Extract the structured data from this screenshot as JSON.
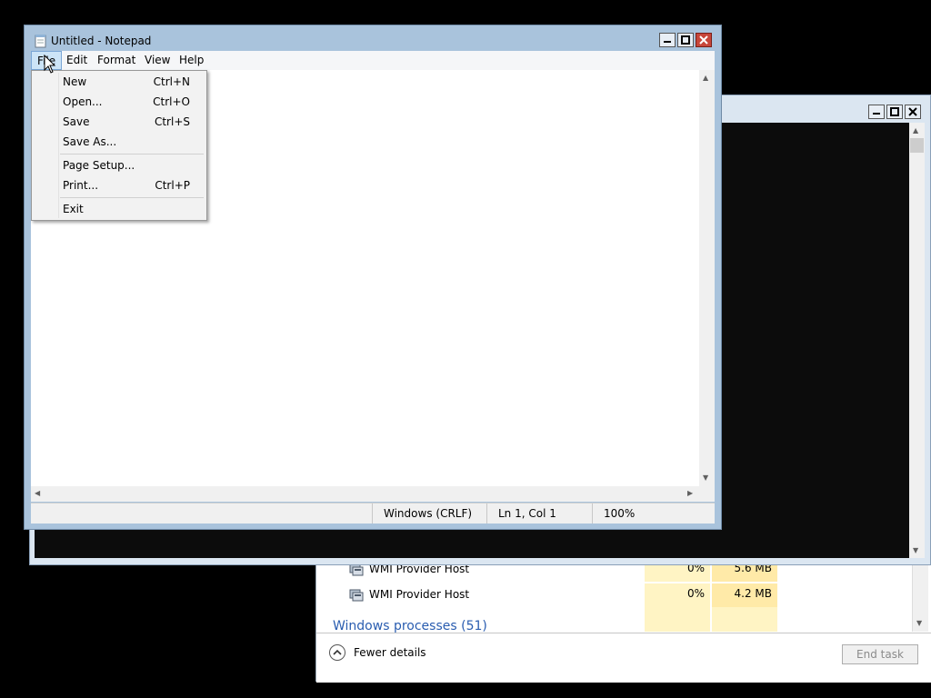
{
  "colors": {
    "titlebar": "#a9c3dc",
    "accent_link": "#2a5db0",
    "cpu_fill": "#fff4c4",
    "mem_fill": "#ffeaa8"
  },
  "taskmgr": {
    "rows": [
      {
        "name": "WMI Provider Host",
        "cpu": "0%",
        "memory": "5.6 MB",
        "icon": "service-host-icon"
      },
      {
        "name": "WMI Provider Host",
        "cpu": "0%",
        "memory": "4.2 MB",
        "icon": "service-host-icon"
      }
    ],
    "group_header": "Windows processes (51)",
    "fewer_details": "Fewer details",
    "end_task": "End task"
  },
  "notepad": {
    "title": "Untitled - Notepad",
    "menu": [
      "File",
      "Edit",
      "Format",
      "View",
      "Help"
    ],
    "file_menu": {
      "items": [
        {
          "label": "New",
          "shortcut": "Ctrl+N"
        },
        {
          "label": "Open...",
          "shortcut": "Ctrl+O"
        },
        {
          "label": "Save",
          "shortcut": "Ctrl+S"
        },
        {
          "label": "Save As...",
          "shortcut": ""
        },
        {
          "label": "Page Setup...",
          "shortcut": ""
        },
        {
          "label": "Print...",
          "shortcut": "Ctrl+P"
        },
        {
          "label": "Exit",
          "shortcut": ""
        }
      ]
    },
    "status": {
      "line_ending": "Windows (CRLF)",
      "position": "Ln 1, Col 1",
      "zoom": "100%"
    }
  }
}
